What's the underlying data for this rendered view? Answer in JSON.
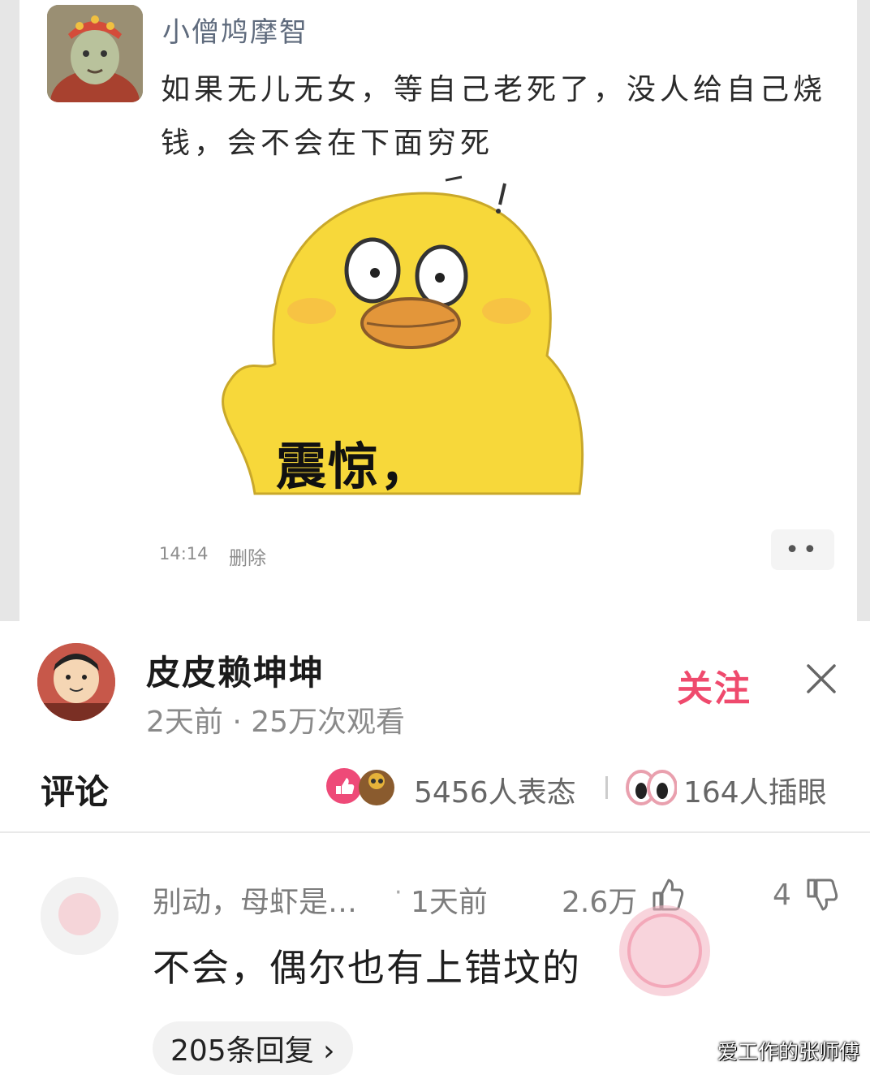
{
  "post": {
    "username": "小僧鸠摩智",
    "text": "如果无儿无女，等自己老死了，没人给自己烧钱，会不会在下面穷死",
    "sticker_caption": "震惊，",
    "time": "14:14",
    "delete_label": "删除",
    "more_label": "••"
  },
  "author": {
    "name": "皮皮赖坤坤",
    "meta": "2天前 · 25万次观看",
    "follow_label": "关注",
    "close_icon": "close-icon"
  },
  "comments_header": {
    "title": "评论",
    "reaction_count": "5456人表态",
    "eye_count": "164人插眼"
  },
  "comment": {
    "user": "别动，母虾是…",
    "dot": "·",
    "time": "1天前",
    "likes": "2.6万",
    "dislikes": "4",
    "text": "不会，偶尔也有上错坟的",
    "replies_label": "205条回复 ›"
  },
  "watermark": "爱工作的张师傅",
  "colors": {
    "accent": "#ef4a6d",
    "sticker_yellow": "#f7d83a",
    "muted_text": "#8a8a8a"
  }
}
